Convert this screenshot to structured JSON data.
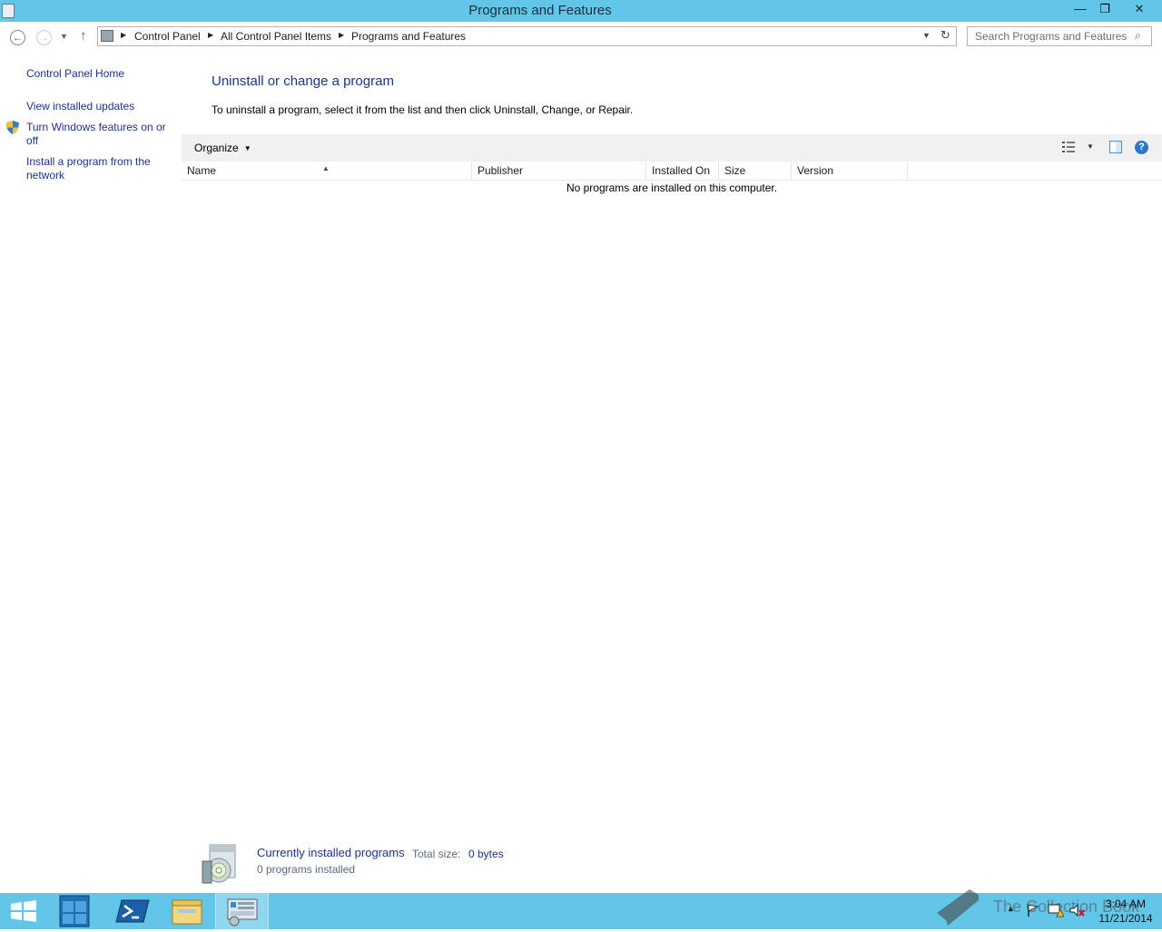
{
  "window": {
    "title": "Programs and Features",
    "minimize_glyph": "—",
    "maximize_glyph": "❐",
    "close_glyph": "✕"
  },
  "nav": {
    "breadcrumbs": [
      "Control Panel",
      "All Control Panel Items",
      "Programs and Features"
    ],
    "search_placeholder": "Search Programs and Features"
  },
  "left_pane": {
    "home": "Control Panel Home",
    "links": [
      "View installed updates",
      "Turn Windows features on or off",
      "Install a program from the network"
    ]
  },
  "main": {
    "title": "Uninstall or change a program",
    "description": "To uninstall a program, select it from the list and then click Uninstall, Change, or Repair.",
    "toolbar": {
      "organize": "Organize"
    },
    "columns": [
      "Name",
      "Publisher",
      "Installed On",
      "Size",
      "Version"
    ],
    "empty_message": "No programs are installed on this computer."
  },
  "details": {
    "title": "Currently installed programs",
    "size_label": "Total size:",
    "size_value": "0 bytes",
    "count": "0 programs installed"
  },
  "taskbar": {
    "time": "3:04 AM",
    "date": "11/21/2014",
    "watermark": "The Collection Book"
  },
  "icons": {
    "help": "?",
    "search": "⌕",
    "refresh": "↻"
  },
  "colors": {
    "accent": "#62c6e9",
    "link": "#1e3287",
    "toolbar_bg": "#f0f0f0"
  }
}
